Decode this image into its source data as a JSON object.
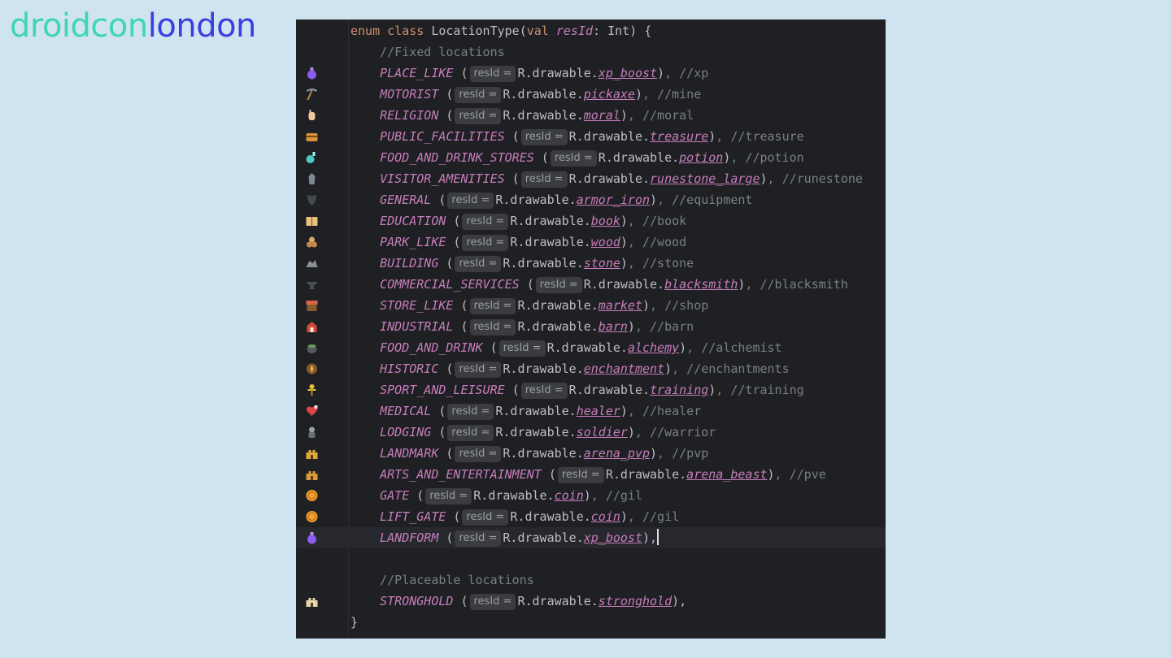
{
  "logo": {
    "part1": "droidcon",
    "part2": "london"
  },
  "editor": {
    "header": {
      "kw_enum": "enum",
      "kw_class": "class",
      "class_name": "LocationType",
      "kw_val": "val",
      "param_name": "resId",
      "param_type": ": Int) {",
      "open_paren": "("
    },
    "comment_fixed": "//Fixed locations",
    "comment_placeable": "//Placeable locations",
    "closing_brace": "}",
    "hint_label": "resId =",
    "drawable_prefix": "R.drawable.",
    "entries": [
      {
        "name": "PLACE_LIKE",
        "res": "xp_boost",
        "comment": ", //xp",
        "icon": "potion-icon",
        "color": "#8a5cf0"
      },
      {
        "name": "MOTORIST",
        "res": "pickaxe",
        "comment": ", //mine",
        "icon": "pickaxe-icon",
        "color": "#b7864e"
      },
      {
        "name": "RELIGION",
        "res": "moral",
        "comment": ", //moral",
        "icon": "hand-icon",
        "color": "#f2c8a0"
      },
      {
        "name": "PUBLIC_FACILITIES",
        "res": "treasure",
        "comment": ", //treasure",
        "icon": "treasure-chest-icon",
        "color": "#d9943b"
      },
      {
        "name": "FOOD_AND_DRINK_STORES",
        "res": "potion",
        "comment": ", //potion",
        "icon": "flask-icon",
        "color": "#4fc7c7"
      },
      {
        "name": "VISITOR_AMENITIES",
        "res": "runestone_large",
        "comment": ", //runestone",
        "icon": "runestone-icon",
        "color": "#7e8a92"
      },
      {
        "name": "GENERAL",
        "res": "armor_iron",
        "comment": ", //equipment",
        "icon": "armor-icon",
        "color": "#55585e"
      },
      {
        "name": "EDUCATION",
        "res": "book",
        "comment": ", //book",
        "icon": "book-icon",
        "color": "#e8c27a"
      },
      {
        "name": "PARK_LIKE",
        "res": "wood",
        "comment": ", //wood",
        "icon": "wood-logs-icon",
        "color": "#c98a48"
      },
      {
        "name": "BUILDING",
        "res": "stone",
        "comment": ", //stone",
        "icon": "stone-icon",
        "color": "#8d9096"
      },
      {
        "name": "COMMERCIAL_SERVICES",
        "res": "blacksmith",
        "comment": ", //blacksmith",
        "icon": "anvil-icon",
        "color": "#3d4046"
      },
      {
        "name": "STORE_LIKE",
        "res": "market",
        "comment": ", //shop",
        "icon": "market-stall-icon",
        "color": "#d9634a"
      },
      {
        "name": "INDUSTRIAL",
        "res": "barn",
        "comment": ", //barn",
        "icon": "barn-icon",
        "color": "#d2493c"
      },
      {
        "name": "FOOD_AND_DRINK",
        "res": "alchemy",
        "comment": ", //alchemist",
        "icon": "cauldron-icon",
        "color": "#5a7a5a"
      },
      {
        "name": "HISTORIC",
        "res": "enchantment",
        "comment": ", //enchantments",
        "icon": "enchantment-icon",
        "color": "#c48a3a"
      },
      {
        "name": "SPORT_AND_LEISURE",
        "res": "training",
        "comment": ", //training",
        "icon": "training-dummy-icon",
        "color": "#e8c23a"
      },
      {
        "name": "MEDICAL",
        "res": "healer",
        "comment": ", //healer",
        "icon": "heart-icon",
        "color": "#e0444a"
      },
      {
        "name": "LODGING",
        "res": "soldier",
        "comment": ", //warrior",
        "icon": "soldier-icon",
        "color": "#9aa0a6"
      },
      {
        "name": "LANDMARK",
        "res": "arena_pvp",
        "comment": ", //pvp",
        "icon": "arena-icon",
        "color": "#e0a93a"
      },
      {
        "name": "ARTS_AND_ENTERTAINMENT",
        "res": "arena_beast",
        "comment": ", //pve",
        "icon": "arena-beast-icon",
        "color": "#d99a3a"
      },
      {
        "name": "GATE",
        "res": "coin",
        "comment": ", //gil",
        "icon": "coin-icon",
        "color": "#f0a030"
      },
      {
        "name": "LIFT_GATE",
        "res": "coin",
        "comment": ", //gil",
        "icon": "coin-icon",
        "color": "#f0a030"
      },
      {
        "name": "LANDFORM",
        "res": "xp_boost",
        "comment": ",",
        "icon": "potion-icon",
        "color": "#8a5cf0"
      }
    ],
    "stronghold": {
      "name": "STRONGHOLD",
      "res": "stronghold",
      "comment": ",",
      "icon": "stronghold-icon",
      "color": "#e8d6a8"
    }
  }
}
